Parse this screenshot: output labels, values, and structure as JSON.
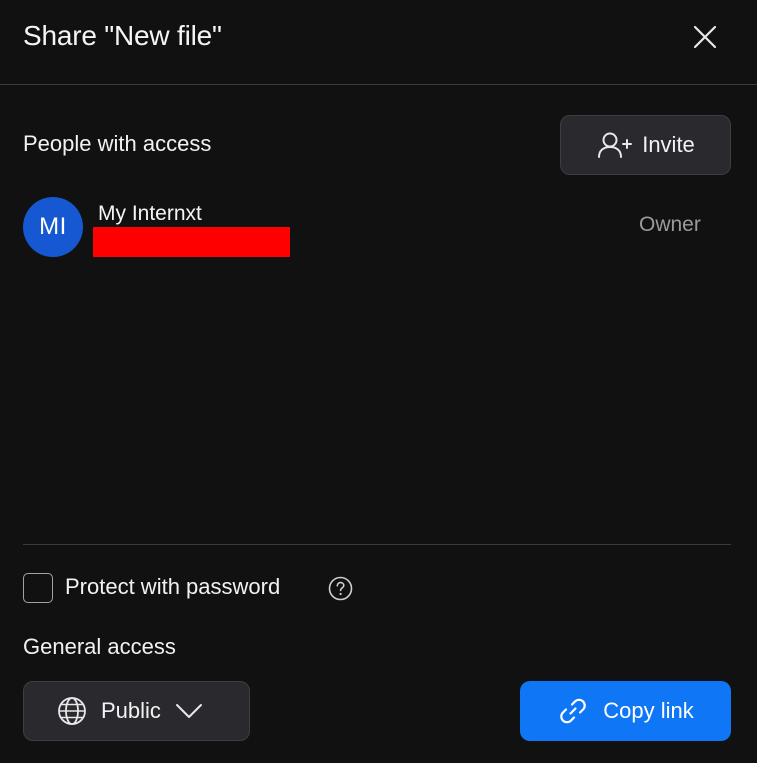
{
  "dialog": {
    "title": "Share \"New file\""
  },
  "people": {
    "label": "People with access",
    "invite_label": "Invite",
    "users": [
      {
        "initials": "MI",
        "name": "My Internxt",
        "role": "Owner"
      }
    ]
  },
  "protect": {
    "label": "Protect with password",
    "checked": false
  },
  "general_access": {
    "label": "General access",
    "selected": "Public"
  },
  "copy_link_label": "Copy link",
  "colors": {
    "background": "#121112",
    "accent": "#0f76f5",
    "avatar": "#1658d1",
    "button_bg": "#2a292e"
  },
  "icons": [
    "close-icon",
    "add-user-icon",
    "help-icon",
    "globe-icon",
    "chevron-down-icon",
    "link-icon"
  ]
}
